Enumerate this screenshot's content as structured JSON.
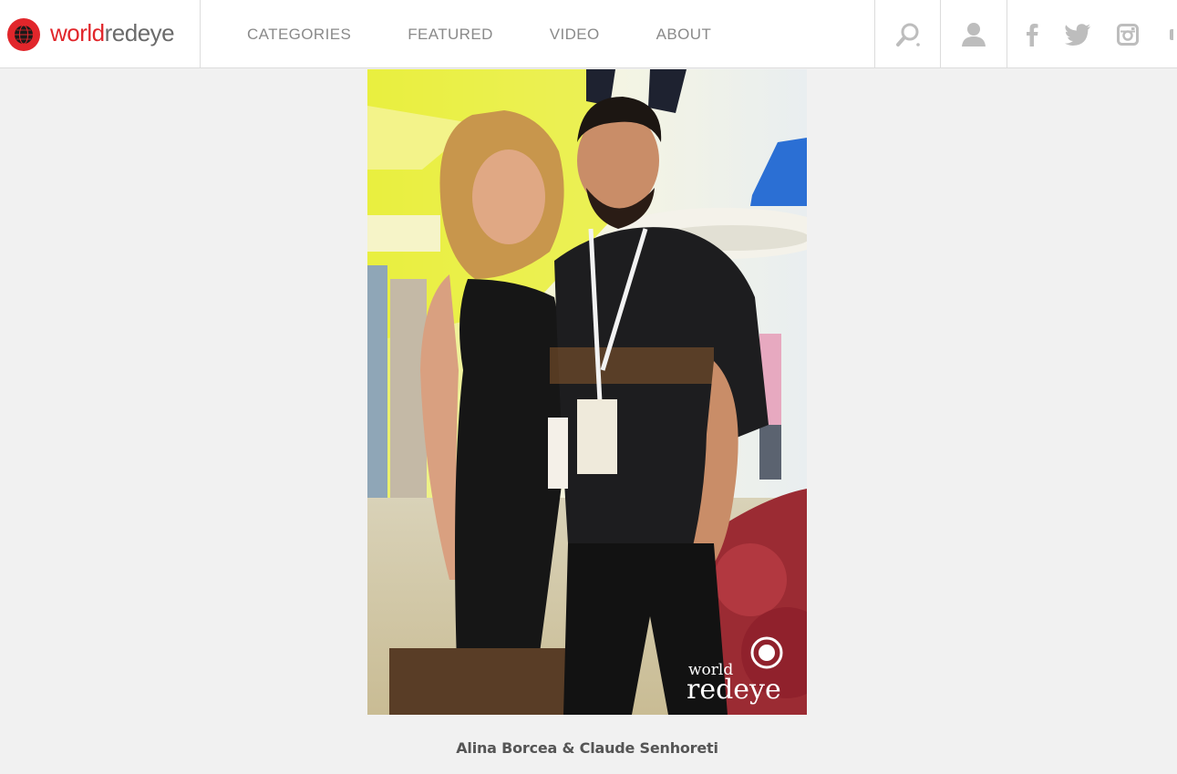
{
  "brand": {
    "world": "world",
    "redeye": "redeye",
    "accent_color": "#e1262b",
    "logo_icon": "globe-icon"
  },
  "nav": {
    "items": [
      "CATEGORIES",
      "FEATURED",
      "VIDEO",
      "ABOUT"
    ]
  },
  "header_icons": [
    "search-icon",
    "user-icon"
  ],
  "social_icons": [
    "facebook-icon",
    "twitter-icon",
    "instagram-icon"
  ],
  "photo": {
    "watermark_line1": "world",
    "watermark_line2": "redeye"
  },
  "caption": "Alina Borcea & Claude Senhoreti"
}
